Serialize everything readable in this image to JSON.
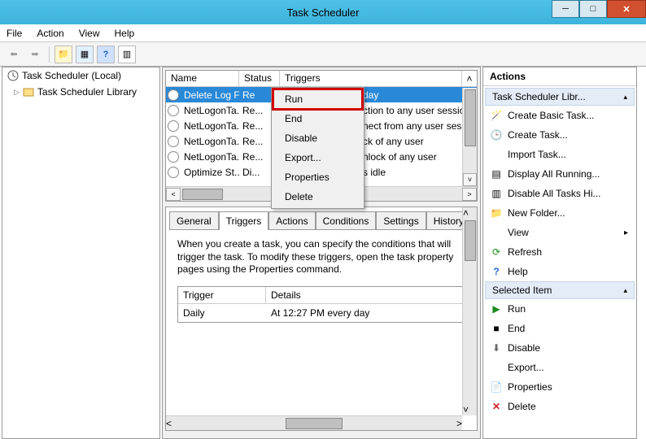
{
  "titlebar": {
    "title": "Task Scheduler"
  },
  "menubar": {
    "file": "File",
    "action": "Action",
    "view": "View",
    "help": "Help"
  },
  "tree": {
    "root": "Task Scheduler (Local)",
    "lib": "Task Scheduler Library"
  },
  "taskcols": {
    "name": "Name",
    "status": "Status",
    "triggers": "Triggers"
  },
  "tasks": [
    {
      "name": "Delete Log F...",
      "status": "Re",
      "triggers": "day"
    },
    {
      "name": "NetLogonTa...",
      "status": "Re...",
      "triggers": "ction to any user sessio"
    },
    {
      "name": "NetLogonTa...",
      "status": "Re...",
      "triggers": "nect from any user sess"
    },
    {
      "name": "NetLogonTa...",
      "status": "Re...",
      "triggers": "ck of any user"
    },
    {
      "name": "NetLogonTa...",
      "status": "Re...",
      "triggers": "nlock of any user"
    },
    {
      "name": "Optimize St...",
      "status": "Di...",
      "triggers": "s idle"
    }
  ],
  "contextmenu": [
    "Run",
    "End",
    "Disable",
    "Export...",
    "Properties",
    "Delete"
  ],
  "details": {
    "tabs": [
      "General",
      "Triggers",
      "Actions",
      "Conditions",
      "Settings",
      "History"
    ],
    "desc": "When you create a task, you can specify the conditions that will trigger the task. To modify these triggers, open the task property pages using the Properties command.",
    "triggerhead": {
      "trigger": "Trigger",
      "details": "Details"
    },
    "triggerrow": {
      "trigger": "Daily",
      "details": "At 12:27 PM every day"
    }
  },
  "actions": {
    "head": "Actions",
    "section1": "Task Scheduler Libr...",
    "items1": [
      "Create Basic Task...",
      "Create Task...",
      "Import Task...",
      "Display All Running...",
      "Disable All Tasks Hi...",
      "New Folder...",
      "View",
      "Refresh",
      "Help"
    ],
    "section2": "Selected Item",
    "items2": [
      "Run",
      "End",
      "Disable",
      "Export...",
      "Properties",
      "Delete"
    ]
  }
}
